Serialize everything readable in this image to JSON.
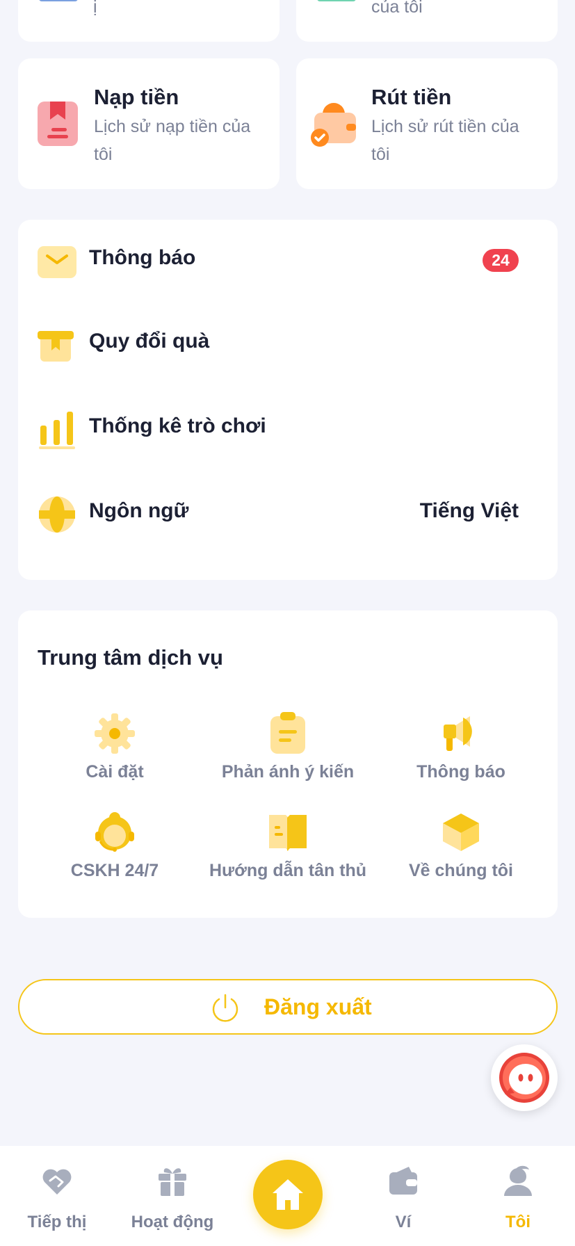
{
  "tiles_top": [
    {
      "subtitle_tail": "ị"
    },
    {
      "subtitle_tail": "của tôi"
    }
  ],
  "tiles": [
    {
      "title": "Nạp tiền",
      "subtitle_line1": "Lịch sử nạp tiền của",
      "subtitle_line2": "tôi",
      "icon": "deposit-book-icon"
    },
    {
      "title": "Rút tiền",
      "subtitle_line1": "Lịch sử rút tiền của",
      "subtitle_line2": "tôi",
      "icon": "wallet-withdraw-icon"
    }
  ],
  "menu": {
    "items": [
      {
        "label": "Thông báo",
        "badge": "24",
        "icon": "envelope-icon"
      },
      {
        "label": "Quy đổi quà",
        "icon": "gift-box-icon"
      },
      {
        "label": "Thống kê trò chơi",
        "icon": "bar-chart-icon"
      },
      {
        "label": "Ngôn ngữ",
        "value": "Tiếng Việt",
        "icon": "globe-icon"
      }
    ]
  },
  "service_center": {
    "title": "Trung tâm dịch vụ",
    "items": [
      {
        "label": "Cài đặt",
        "icon": "gear-icon"
      },
      {
        "label": "Phản ánh ý kiến",
        "icon": "clipboard-icon"
      },
      {
        "label": "Thông báo",
        "icon": "megaphone-icon"
      },
      {
        "label": "CSKH 24/7",
        "icon": "support-agent-icon"
      },
      {
        "label": "Hướng dẫn tân thủ",
        "icon": "open-book-icon"
      },
      {
        "label": "Về chúng tôi",
        "icon": "cube-icon"
      }
    ]
  },
  "logout": {
    "label": "Đăng xuất"
  },
  "tabbar": {
    "items": [
      {
        "label": "Tiếp thị",
        "icon": "heart-handshake-icon"
      },
      {
        "label": "Hoạt động",
        "icon": "gift-icon"
      },
      {
        "label": "",
        "icon": "home-icon"
      },
      {
        "label": "Ví",
        "icon": "wallet-icon"
      },
      {
        "label": "Tôi",
        "icon": "user-icon"
      }
    ],
    "active_index": 4
  },
  "colors": {
    "accent": "#f5c518",
    "active_tab": "#f5b800",
    "badge": "#f0424f",
    "muted": "#7b8196",
    "background": "#f4f5fb"
  }
}
